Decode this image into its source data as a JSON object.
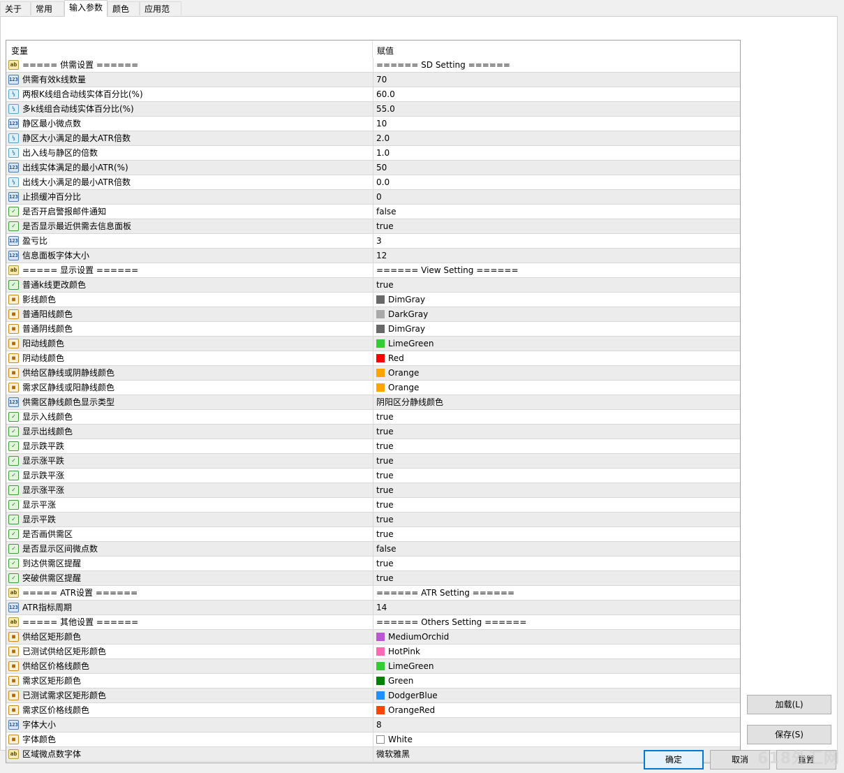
{
  "tabs": [
    "关于",
    "常用",
    "输入参数",
    "颜色",
    "应用范围"
  ],
  "active_tab": 2,
  "grid": {
    "header": {
      "name": "变量",
      "value": "赋值"
    },
    "rows": [
      {
        "icon": "ab",
        "name": "===== 供需设置 ======",
        "value": "====== SD Setting ======"
      },
      {
        "icon": "123",
        "name": "供需有效k线数量",
        "value": "70"
      },
      {
        "icon": "1/2",
        "name": "两根K线组合动线实体百分比(%)",
        "value": "60.0"
      },
      {
        "icon": "1/2",
        "name": "多k线组合动线实体百分比(%)",
        "value": "55.0"
      },
      {
        "icon": "123",
        "name": "静区最小微点数",
        "value": "10"
      },
      {
        "icon": "1/2",
        "name": "静区大小满足的最大ATR倍数",
        "value": "2.0"
      },
      {
        "icon": "1/2",
        "name": "出入线与静区的倍数",
        "value": "1.0"
      },
      {
        "icon": "123",
        "name": "出线实体满足的最小ATR(%)",
        "value": "50"
      },
      {
        "icon": "1/2",
        "name": "出线大小满足的最小ATR倍数",
        "value": "0.0"
      },
      {
        "icon": "123",
        "name": "止损缓冲百分比",
        "value": "0"
      },
      {
        "icon": "bool",
        "name": "是否开启警报邮件通知",
        "value": "false"
      },
      {
        "icon": "bool",
        "name": "是否显示最近供需去信息面板",
        "value": "true"
      },
      {
        "icon": "123",
        "name": "盈亏比",
        "value": "3"
      },
      {
        "icon": "123",
        "name": "信息面板字体大小",
        "value": "12"
      },
      {
        "icon": "ab",
        "name": "===== 显示设置 ======",
        "value": "====== View Setting ======"
      },
      {
        "icon": "bool",
        "name": "普通k线更改颜色",
        "value": "true"
      },
      {
        "icon": "color",
        "name": "影线颜色",
        "value": "DimGray",
        "swatch": "#696969"
      },
      {
        "icon": "color",
        "name": "普通阳线颜色",
        "value": "DarkGray",
        "swatch": "#a9a9a9"
      },
      {
        "icon": "color",
        "name": "普通阴线颜色",
        "value": "DimGray",
        "swatch": "#696969"
      },
      {
        "icon": "color",
        "name": "阳动线颜色",
        "value": "LimeGreen",
        "swatch": "#32cd32"
      },
      {
        "icon": "color",
        "name": "阴动线颜色",
        "value": "Red",
        "swatch": "#ff0000"
      },
      {
        "icon": "color",
        "name": "供给区静线或阴静线颜色",
        "value": "Orange",
        "swatch": "#ffa500"
      },
      {
        "icon": "color",
        "name": "需求区静线或阳静线颜色",
        "value": "Orange",
        "swatch": "#ffa500"
      },
      {
        "icon": "123",
        "name": "供需区静线颜色显示类型",
        "value": "阴阳区分静线颜色"
      },
      {
        "icon": "bool",
        "name": "显示入线颜色",
        "value": "true"
      },
      {
        "icon": "bool",
        "name": "显示出线颜色",
        "value": "true"
      },
      {
        "icon": "bool",
        "name": "显示跌平跌",
        "value": "true"
      },
      {
        "icon": "bool",
        "name": "显示涨平跌",
        "value": "true"
      },
      {
        "icon": "bool",
        "name": "显示跌平涨",
        "value": "true"
      },
      {
        "icon": "bool",
        "name": "显示涨平涨",
        "value": "true"
      },
      {
        "icon": "bool",
        "name": "显示平涨",
        "value": "true"
      },
      {
        "icon": "bool",
        "name": "显示平跌",
        "value": "true"
      },
      {
        "icon": "bool",
        "name": "是否画供需区",
        "value": "true"
      },
      {
        "icon": "bool",
        "name": "是否显示区间微点数",
        "value": "false"
      },
      {
        "icon": "bool",
        "name": "到达供需区提醒",
        "value": "true"
      },
      {
        "icon": "bool",
        "name": "突破供需区提醒",
        "value": "true"
      },
      {
        "icon": "ab",
        "name": "===== ATR设置 ======",
        "value": "====== ATR Setting ======"
      },
      {
        "icon": "123",
        "name": "ATR指标周期",
        "value": "14"
      },
      {
        "icon": "ab",
        "name": "===== 其他设置 ======",
        "value": "====== Others Setting ======"
      },
      {
        "icon": "color",
        "name": "供给区矩形颜色",
        "value": "MediumOrchid",
        "swatch": "#ba55d3"
      },
      {
        "icon": "color",
        "name": "已测试供给区矩形颜色",
        "value": "HotPink",
        "swatch": "#ff69b4"
      },
      {
        "icon": "color",
        "name": "供给区价格线颜色",
        "value": "LimeGreen",
        "swatch": "#32cd32"
      },
      {
        "icon": "color",
        "name": "需求区矩形颜色",
        "value": "Green",
        "swatch": "#008000"
      },
      {
        "icon": "color",
        "name": "已测试需求区矩形颜色",
        "value": "DodgerBlue",
        "swatch": "#1e90ff"
      },
      {
        "icon": "color",
        "name": "需求区价格线颜色",
        "value": "OrangeRed",
        "swatch": "#ff4500"
      },
      {
        "icon": "123",
        "name": "字体大小",
        "value": "8"
      },
      {
        "icon": "color",
        "name": "字体颜色",
        "value": "White",
        "swatch": "#ffffff"
      },
      {
        "icon": "ab",
        "name": "区域微点数字体",
        "value": "微软雅黑"
      }
    ]
  },
  "buttons": {
    "load": "加载(L)",
    "save": "保存(S)",
    "ok": "确定",
    "cancel": "取消",
    "reset": "重置"
  },
  "watermark": "618外汇网"
}
